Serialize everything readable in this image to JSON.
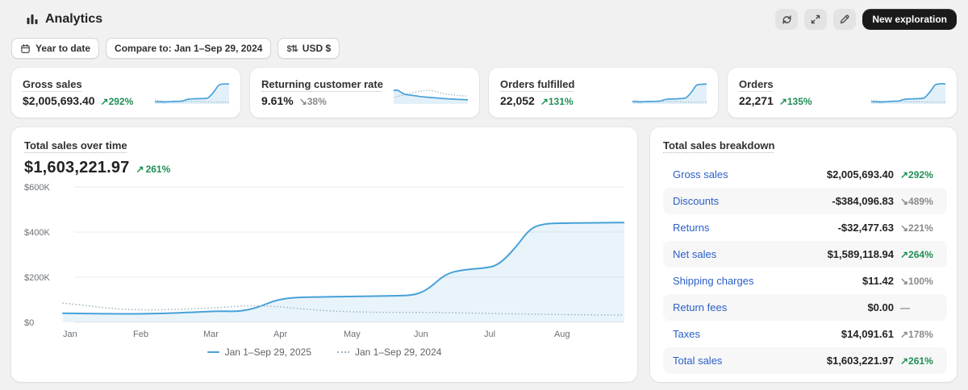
{
  "header": {
    "title": "Analytics",
    "new_exploration": "New exploration"
  },
  "filters": {
    "date_range": "Year to date",
    "compare": "Compare to: Jan 1–Sep 29, 2024",
    "currency": "USD $",
    "currency_icon": "$⇅"
  },
  "metrics": [
    {
      "label": "Gross sales",
      "value": "$2,005,693.40",
      "arrow": "↗",
      "change": "292%",
      "tone": "positive",
      "spark": 0
    },
    {
      "label": "Returning customer rate",
      "value": "9.61%",
      "arrow": "↘",
      "change": "38%",
      "tone": "neutral",
      "spark": 1
    },
    {
      "label": "Orders fulfilled",
      "value": "22,052",
      "arrow": "↗",
      "change": "131%",
      "tone": "positive",
      "spark": 2
    },
    {
      "label": "Orders",
      "value": "22,271",
      "arrow": "↗",
      "change": "135%",
      "tone": "positive",
      "spark": 3
    }
  ],
  "sparklines": [
    {
      "line": [
        10,
        10,
        9,
        9,
        10,
        11,
        12,
        12,
        13,
        21,
        23,
        24,
        24,
        25,
        25,
        26,
        42,
        62,
        88,
        91,
        92,
        92
      ],
      "compare": [
        17,
        15,
        13,
        12,
        12,
        12,
        13,
        13,
        12,
        11,
        11,
        10,
        10,
        10,
        9,
        9,
        9,
        8,
        8,
        8,
        8,
        8
      ]
    },
    {
      "line": [
        62,
        66,
        54,
        45,
        42,
        40,
        38,
        35,
        33,
        32,
        30,
        29,
        28,
        26,
        25,
        24,
        23,
        22,
        21,
        21,
        20,
        19
      ],
      "compare": [
        30,
        34,
        38,
        42,
        46,
        50,
        54,
        57,
        60,
        62,
        63,
        61,
        57,
        52,
        48,
        45,
        43,
        41,
        39,
        38,
        37,
        36
      ]
    },
    {
      "line": [
        10,
        10,
        9,
        10,
        11,
        11,
        12,
        12,
        13,
        20,
        22,
        23,
        23,
        24,
        25,
        26,
        40,
        60,
        87,
        90,
        91,
        91
      ],
      "compare": [
        16,
        15,
        13,
        12,
        12,
        12,
        12,
        12,
        12,
        11,
        11,
        10,
        10,
        10,
        9,
        9,
        9,
        8,
        8,
        8,
        8,
        8
      ]
    },
    {
      "line": [
        10,
        10,
        9,
        9,
        10,
        11,
        12,
        13,
        13,
        21,
        22,
        23,
        24,
        24,
        25,
        26,
        43,
        63,
        89,
        92,
        93,
        92
      ],
      "compare": [
        17,
        15,
        13,
        12,
        12,
        12,
        13,
        12,
        12,
        11,
        11,
        10,
        10,
        10,
        9,
        9,
        9,
        8,
        8,
        8,
        8,
        8
      ]
    }
  ],
  "main_chart": {
    "title": "Total sales over time",
    "value": "$1,603,221.97",
    "arrow": "↗",
    "change": "261%",
    "tone": "positive"
  },
  "chart_data": {
    "type": "line",
    "title": "Total sales over time",
    "x_labels": [
      "Jan",
      "Feb",
      "Mar",
      "Apr",
      "May",
      "Jun",
      "Jul",
      "Aug"
    ],
    "x_domain": [
      0,
      8
    ],
    "y_ticks": [
      {
        "label": "$600K",
        "value": 600
      },
      {
        "label": "$400K",
        "value": 400
      },
      {
        "label": "$200K",
        "value": 200
      },
      {
        "label": "$0",
        "value": 0
      }
    ],
    "y_unit": "thousand USD",
    "ylim": [
      0,
      600
    ],
    "grid": true,
    "legend_position": "bottom",
    "series": [
      {
        "name": "Jan 1–Sep 29, 2025",
        "style": "solid",
        "points": [
          [
            0,
            40
          ],
          [
            0.4,
            39
          ],
          [
            0.9,
            37
          ],
          [
            1.4,
            39
          ],
          [
            1.9,
            45
          ],
          [
            2.2,
            50
          ],
          [
            2.45,
            48
          ],
          [
            2.65,
            55
          ],
          [
            2.85,
            75
          ],
          [
            3.05,
            100
          ],
          [
            3.3,
            110
          ],
          [
            3.7,
            113
          ],
          [
            4.2,
            115
          ],
          [
            4.7,
            117
          ],
          [
            5.0,
            120
          ],
          [
            5.2,
            145
          ],
          [
            5.45,
            215
          ],
          [
            5.7,
            233
          ],
          [
            6.0,
            240
          ],
          [
            6.2,
            252
          ],
          [
            6.45,
            330
          ],
          [
            6.65,
            415
          ],
          [
            6.85,
            437
          ],
          [
            7.1,
            440
          ],
          [
            7.5,
            441
          ],
          [
            8,
            442
          ]
        ]
      },
      {
        "name": "Jan 1–Sep 29, 2024",
        "style": "dotted",
        "points": [
          [
            0,
            85
          ],
          [
            0.3,
            76
          ],
          [
            0.7,
            60
          ],
          [
            1.1,
            55
          ],
          [
            1.5,
            56
          ],
          [
            1.9,
            60
          ],
          [
            2.2,
            65
          ],
          [
            2.5,
            71
          ],
          [
            2.75,
            74
          ],
          [
            3.0,
            71
          ],
          [
            3.3,
            63
          ],
          [
            3.6,
            55
          ],
          [
            3.9,
            49
          ],
          [
            4.2,
            46
          ],
          [
            4.6,
            44
          ],
          [
            5.0,
            44
          ],
          [
            5.5,
            43
          ],
          [
            6.0,
            40
          ],
          [
            6.5,
            37
          ],
          [
            7.0,
            35
          ],
          [
            7.5,
            33
          ],
          [
            8,
            32
          ]
        ]
      }
    ]
  },
  "breakdown": {
    "title": "Total sales breakdown",
    "rows": [
      {
        "label": "Gross sales",
        "value": "$2,005,693.40",
        "arrow": "↗",
        "change": "292%",
        "tone": "positive",
        "shaded": false
      },
      {
        "label": "Discounts",
        "value": "-$384,096.83",
        "arrow": "↘",
        "change": "489%",
        "tone": "neutral",
        "shaded": true
      },
      {
        "label": "Returns",
        "value": "-$32,477.63",
        "arrow": "↘",
        "change": "221%",
        "tone": "neutral",
        "shaded": false
      },
      {
        "label": "Net sales",
        "value": "$1,589,118.94",
        "arrow": "↗",
        "change": "264%",
        "tone": "positive",
        "shaded": true
      },
      {
        "label": "Shipping charges",
        "value": "$11.42",
        "arrow": "↘",
        "change": "100%",
        "tone": "neutral",
        "shaded": false
      },
      {
        "label": "Return fees",
        "value": "$0.00",
        "arrow": "",
        "change": "—",
        "tone": "neutral",
        "shaded": true
      },
      {
        "label": "Taxes",
        "value": "$14,091.61",
        "arrow": "↗",
        "change": "178%",
        "tone": "neutral",
        "shaded": false
      },
      {
        "label": "Total sales",
        "value": "$1,603,221.97",
        "arrow": "↗",
        "change": "261%",
        "tone": "positive",
        "shaded": true
      }
    ]
  },
  "colors": {
    "accent_blue": "#47a1d9",
    "accent_fill": "rgba(71,161,217,0.12)",
    "compare_gray": "#9fb6c3",
    "positive_green": "#1f8f55",
    "neutral_gray": "#8a8a8a",
    "link_blue": "#2b5fc7",
    "grid_gray": "#ebebeb",
    "axis_text": "#6b7177",
    "page_bg": "#f1f1f1"
  }
}
